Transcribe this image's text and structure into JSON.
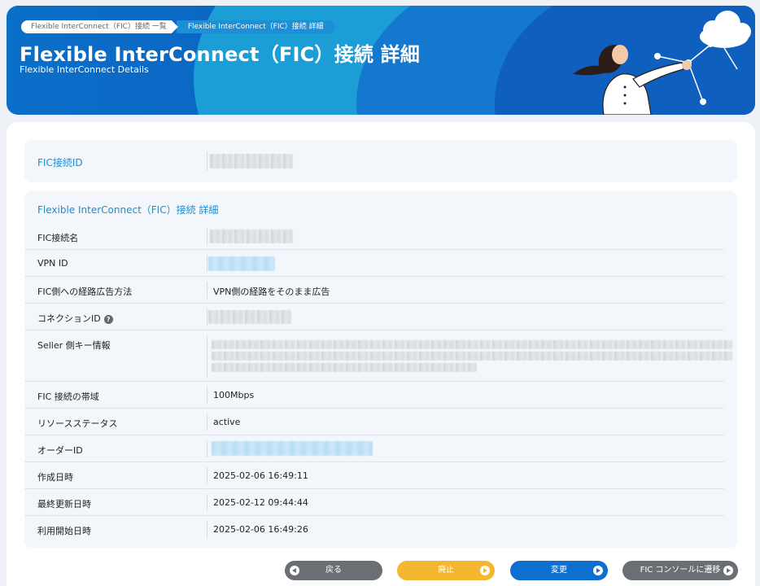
{
  "breadcrumb": {
    "items": [
      "Flexible InterConnect（FIC）接続 一覧",
      "Flexible InterConnect（FIC）接続 詳細"
    ]
  },
  "header": {
    "title": "Flexible InterConnect（FIC）接続 詳細",
    "subtitle": "Flexible InterConnect Details"
  },
  "id_card": {
    "label": "FIC接続ID"
  },
  "detail": {
    "heading": "Flexible InterConnect（FIC）接続 詳細",
    "rows": [
      {
        "key": "FIC接続名",
        "value": ""
      },
      {
        "key": "VPN ID",
        "value": ""
      },
      {
        "key": "FIC側への経路広告方法",
        "value": "VPN側の経路をそのまま広告"
      },
      {
        "key": "コネクションID",
        "value": ""
      },
      {
        "key": "Seller 側キー情報",
        "value": ""
      },
      {
        "key": "FIC 接続の帯域",
        "value": "100Mbps"
      },
      {
        "key": "リソースステータス",
        "value": "active"
      },
      {
        "key": "オーダーID",
        "value": ""
      },
      {
        "key": "作成日時",
        "value": "2025-02-06 16:49:11"
      },
      {
        "key": "最終更新日時",
        "value": "2025-02-12 09:44:44"
      },
      {
        "key": "利用開始日時",
        "value": "2025-02-06 16:49:26"
      }
    ],
    "help_icon": "?"
  },
  "buttons": {
    "back": "戻る",
    "cancel": "廃止",
    "change": "変更",
    "console": "FIC コンソールに遷移"
  },
  "colors": {
    "accent": "#1b8ed0",
    "banner": "#0c63c2",
    "back_button": "#6b6f73",
    "cancel_button": "#f5b730",
    "change_button": "#0f6fd1"
  },
  "icons": {
    "help": "help-icon",
    "arrow_left": "arrow-left-icon",
    "arrow_right": "arrow-right-icon"
  }
}
